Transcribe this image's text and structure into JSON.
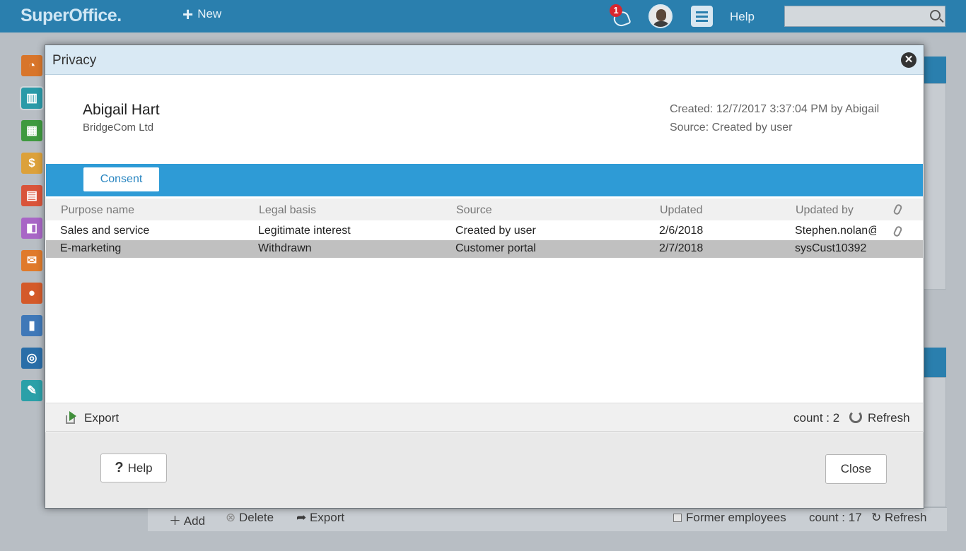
{
  "app": {
    "logo": "SuperOffice.",
    "new_label": "New",
    "notification_count": "1",
    "help_label": "Help",
    "search_placeholder": ""
  },
  "background": {
    "footer": {
      "add_label": "Add",
      "delete_label": "Delete",
      "export_label": "Export",
      "former_employees_label": "Former employees",
      "count_label": "count : 17",
      "refresh_label": "Refresh"
    }
  },
  "modal": {
    "title": "Privacy",
    "person": {
      "name": "Abigail Hart",
      "company": "BridgeCom Ltd"
    },
    "created": "Created: 12/7/2017 3:37:04 PM by Abigail",
    "source": "Source:  Created by user",
    "tabs": [
      {
        "label": "Consent"
      }
    ],
    "grid": {
      "columns": [
        "Purpose name",
        "Legal basis",
        "Source",
        "Updated",
        "Updated by"
      ],
      "rows": [
        {
          "purpose": "Sales and service",
          "legal_basis": "Legitimate interest",
          "source": "Created by user",
          "updated": "2/6/2018",
          "updated_by": "Stephen.nolan@",
          "attachment": true,
          "selected": false
        },
        {
          "purpose": "E-marketing",
          "legal_basis": "Withdrawn",
          "source": "Customer portal",
          "updated": "2/7/2018",
          "updated_by": "sysCust10392",
          "attachment": false,
          "selected": true
        }
      ]
    },
    "footer": {
      "export_label": "Export",
      "count_label": "count : 2",
      "refresh_label": "Refresh"
    },
    "buttons": {
      "help_label": "Help",
      "close_label": "Close"
    }
  },
  "colors": {
    "topbar": "#2a7fae",
    "tabbar": "#2e9bd6",
    "selected_row": "#c0c0c0"
  }
}
